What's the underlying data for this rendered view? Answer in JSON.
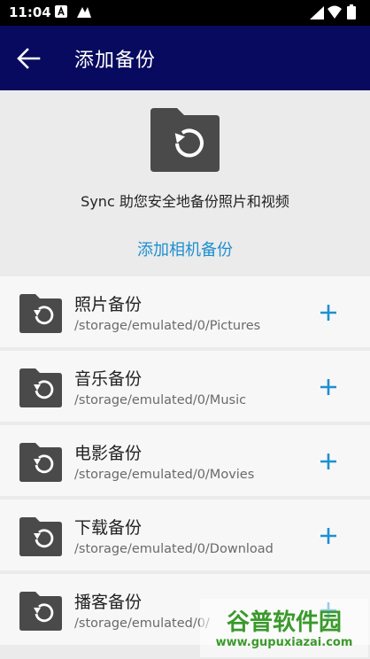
{
  "status_bar": {
    "time": "11:04",
    "left_icons": [
      "a-notification-icon",
      "sync-notification-icon"
    ],
    "right_icons": [
      "signal-icon",
      "wifi-icon",
      "battery-icon"
    ]
  },
  "app_bar": {
    "back_icon": "arrow-back-icon",
    "title": "添加备份",
    "background": "#070a5e"
  },
  "hero": {
    "icon": "folder-restore-icon",
    "description": "Sync 助您安全地备份照片和视频",
    "link_label": "添加相机备份",
    "link_color": "#1e8fd1"
  },
  "backup_items": [
    {
      "title": "照片备份",
      "path": "/storage/emulated/0/Pictures"
    },
    {
      "title": "音乐备份",
      "path": "/storage/emulated/0/Music"
    },
    {
      "title": "电影备份",
      "path": "/storage/emulated/0/Movies"
    },
    {
      "title": "下载备份",
      "path": "/storage/emulated/0/Download"
    },
    {
      "title": "播客备份",
      "path": "/storage/emulated/0/"
    }
  ],
  "add_icon": "plus-icon",
  "accent_color": "#1e8fd1",
  "watermark": {
    "brand": "谷普软件园",
    "url": "www.gupuxiazai.com"
  }
}
